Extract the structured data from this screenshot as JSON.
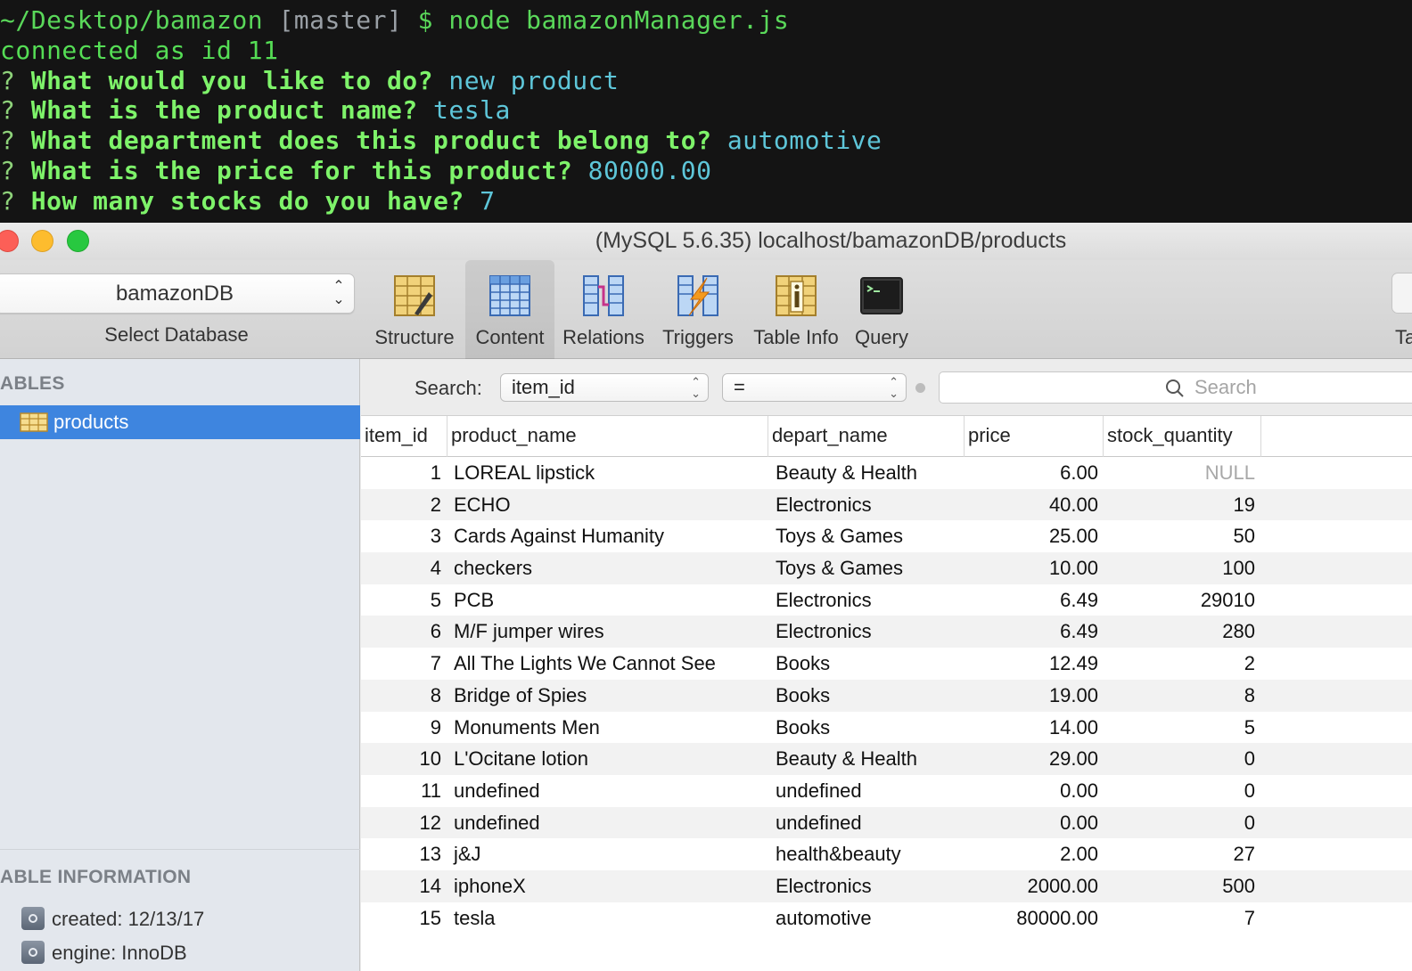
{
  "terminal": {
    "prompt_path": "~/Desktop/bamazon",
    "prompt_branch": "[master]",
    "prompt_symbol": "$",
    "command": "node bamazonManager.js",
    "connected": "connected as id 11",
    "qa": [
      {
        "q": "What would you like to do?",
        "a": "new product"
      },
      {
        "q": "What is the product name?",
        "a": "tesla"
      },
      {
        "q": "What department does this product belong to?",
        "a": "automotive"
      },
      {
        "q": "What is the price for this product?",
        "a": "80000.00"
      },
      {
        "q": "How many stocks do you have?",
        "a": "7"
      }
    ]
  },
  "window": {
    "title": "(MySQL 5.6.35) localhost/bamazonDB/products"
  },
  "toolbar": {
    "database": "bamazonDB",
    "database_label": "Select Database",
    "buttons": [
      {
        "label": "Structure",
        "icon": "structure-icon"
      },
      {
        "label": "Content",
        "icon": "content-icon"
      },
      {
        "label": "Relations",
        "icon": "relations-icon"
      },
      {
        "label": "Triggers",
        "icon": "triggers-icon"
      },
      {
        "label": "Table Info",
        "icon": "table-info-icon"
      },
      {
        "label": "Query",
        "icon": "query-icon"
      }
    ],
    "edge_label": "Ta"
  },
  "sidebar": {
    "tables_heading": "ABLES",
    "tables": [
      "products"
    ],
    "info_heading": "ABLE INFORMATION",
    "info": [
      "created: 12/13/17",
      "engine: InnoDB"
    ]
  },
  "filter": {
    "label": "Search:",
    "field": "item_id",
    "operator": "=",
    "placeholder": "Search"
  },
  "table": {
    "columns": [
      "item_id",
      "product_name",
      "depart_name",
      "price",
      "stock_quantity"
    ],
    "rows": [
      [
        "1",
        "LOREAL lipstick",
        "Beauty & Health",
        "6.00",
        "NULL"
      ],
      [
        "2",
        "ECHO",
        "Electronics",
        "40.00",
        "19"
      ],
      [
        "3",
        "Cards Against Humanity",
        "Toys & Games",
        "25.00",
        "50"
      ],
      [
        "4",
        "checkers",
        "Toys & Games",
        "10.00",
        "100"
      ],
      [
        "5",
        "PCB",
        "Electronics",
        "6.49",
        "29010"
      ],
      [
        "6",
        "M/F jumper wires",
        "Electronics",
        "6.49",
        "280"
      ],
      [
        "7",
        "All The Lights We Cannot See",
        "Books",
        "12.49",
        "2"
      ],
      [
        "8",
        "Bridge of Spies",
        "Books",
        "19.00",
        "8"
      ],
      [
        "9",
        "Monuments Men",
        "Books",
        "14.00",
        "5"
      ],
      [
        "10",
        "L'Ocitane lotion",
        "Beauty & Health",
        "29.00",
        "0"
      ],
      [
        "11",
        "undefined",
        "undefined",
        "0.00",
        "0"
      ],
      [
        "12",
        "undefined",
        "undefined",
        "0.00",
        "0"
      ],
      [
        "13",
        "j&J",
        "health&beauty",
        "2.00",
        "27"
      ],
      [
        "14",
        "iphoneX",
        "Electronics",
        "2000.00",
        "500"
      ],
      [
        "15",
        "tesla",
        "automotive",
        "80000.00",
        "7"
      ]
    ]
  },
  "colors": {
    "terminal_bg": "#141414",
    "prompt_green": "#7ef36a",
    "answer_cyan": "#5ec6d9",
    "selection_blue": "#3e85df",
    "null_gray": "#a8a8a8"
  }
}
